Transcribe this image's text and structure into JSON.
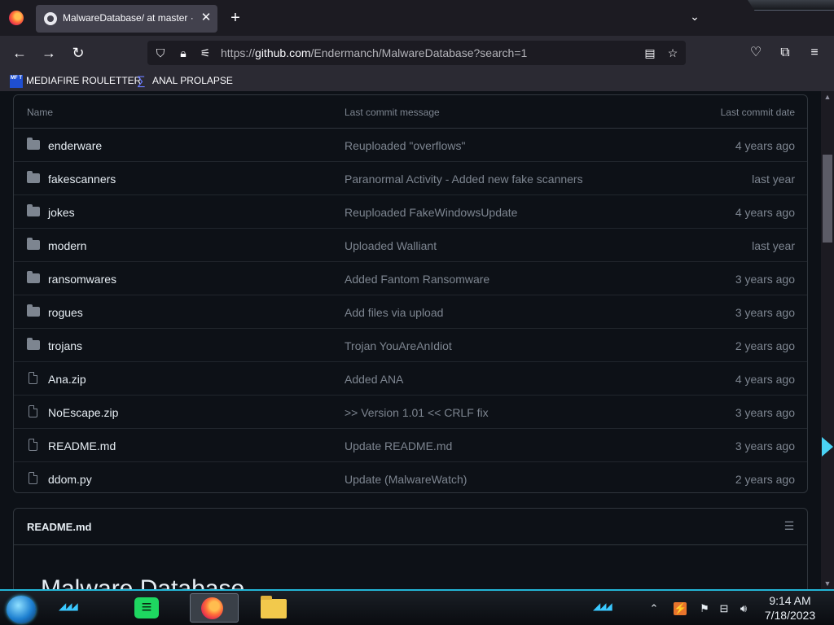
{
  "browser": {
    "tab_title": "MalwareDatabase/ at master · E",
    "new_tab": "+",
    "url_prefix": "https://",
    "url_main": "github.com",
    "url_path": "/Endermanch/MalwareDatabase?search=1"
  },
  "bookmarks": [
    {
      "icon": "mediafire-icon",
      "icon_text": "MF T",
      "label": "MEDIAFIRE ROULETTER"
    },
    {
      "icon": "sigma-icon",
      "label": "ANAL PROLAPSE"
    }
  ],
  "file_table": {
    "headers": {
      "name": "Name",
      "message": "Last commit message",
      "date": "Last commit date"
    },
    "rows": [
      {
        "type": "folder",
        "name": "enderware",
        "message": "Reuploaded \"overflows\"",
        "date": "4 years ago"
      },
      {
        "type": "folder",
        "name": "fakescanners",
        "message": "Paranormal Activity - Added new fake scanners",
        "date": "last year"
      },
      {
        "type": "folder",
        "name": "jokes",
        "message": "Reuploaded FakeWindowsUpdate",
        "date": "4 years ago"
      },
      {
        "type": "folder",
        "name": "modern",
        "message": "Uploaded Walliant",
        "date": "last year"
      },
      {
        "type": "folder",
        "name": "ransomwares",
        "message": "Added Fantom Ransomware",
        "date": "3 years ago"
      },
      {
        "type": "folder",
        "name": "rogues",
        "message": "Add files via upload",
        "date": "3 years ago"
      },
      {
        "type": "folder",
        "name": "trojans",
        "message": "Trojan YouAreAnIdiot",
        "date": "2 years ago"
      },
      {
        "type": "file",
        "name": "Ana.zip",
        "message": "Added ANA",
        "date": "4 years ago"
      },
      {
        "type": "file",
        "name": "NoEscape.zip",
        "message": ">> Version 1.01 << CRLF fix",
        "date": "3 years ago"
      },
      {
        "type": "file",
        "name": "README.md",
        "message": "Update README.md",
        "date": "3 years ago"
      },
      {
        "type": "file",
        "name": "ddom.py",
        "message": "Update (MalwareWatch)",
        "date": "2 years ago"
      }
    ]
  },
  "readme": {
    "title": "README.md",
    "heading": "Malware Database"
  },
  "taskbar": {
    "time": "9:14 AM",
    "date": "7/18/2023",
    "apps": [
      "spotify-icon",
      "firefox-icon",
      "file-explorer-icon"
    ]
  },
  "colors": {
    "page_bg": "#0d1117",
    "border": "#30363d",
    "text_primary": "#e6edf3",
    "text_muted": "#7d8590",
    "taskbar_accent": "#23b5d6"
  }
}
